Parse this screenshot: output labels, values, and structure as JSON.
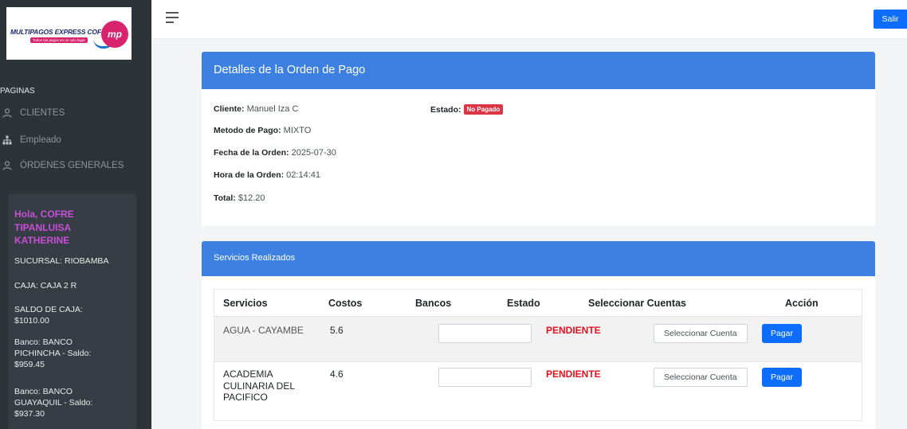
{
  "brand": {
    "name": "MULTIPAGOS EXPRESS COFRE",
    "tagline": "Todos tus pagos en un solo lugar",
    "mark": "mp"
  },
  "sidebar": {
    "section_label": "PAGINAS",
    "items": [
      {
        "label": "CLIENTES",
        "icon": "user-icon"
      },
      {
        "label": "Empleado",
        "icon": "org-chart-icon"
      },
      {
        "label": "ÓRDENES GENERALES",
        "icon": "user-icon"
      }
    ],
    "user": {
      "greeting": "Hola, COFRE TIPANLUISA KATHERINE",
      "sucursal": "SUCURSAL: RIOBAMBA",
      "caja": "CAJA: CAJA 2 R",
      "saldo": "SALDO DE CAJA: $1010.00",
      "banco1": "Banco: BANCO PICHINCHA - Saldo: $959.45",
      "banco2": "Banco: BANCO GUAYAQUIL - Saldo: $937.30"
    }
  },
  "topbar": {
    "logout_label": "Salir"
  },
  "order": {
    "title": "Detalles de la Orden de Pago",
    "cliente_label": "Cliente:",
    "cliente_value": "Manuel Iza C",
    "estado_label": "Estado:",
    "estado_value": "No Pagado",
    "metodo_label": "Metodo de Pago:",
    "metodo_value": "MIXTO",
    "fecha_label": "Fecha de la Orden:",
    "fecha_value": "2025-07-30",
    "hora_label": "Hora de la Orden:",
    "hora_value": "02:14:41",
    "total_label": "Total:",
    "total_value": "$12.20"
  },
  "services": {
    "title": "Servicios Realizados",
    "columns": [
      "Servicios",
      "Costos",
      "Bancos",
      "Estado",
      "Seleccionar Cuentas",
      "Acción"
    ],
    "rows": [
      {
        "servicio": "AGUA - CAYAMBE",
        "costo": "5.6",
        "banco": "",
        "estado": "PENDIENTE",
        "cuenta_placeholder": "Seleccionar Cuenta",
        "accion": "Pagar"
      },
      {
        "servicio": "ACADEMIA CULINARIA DEL PACIFICO",
        "costo": "4.6",
        "banco": "",
        "estado": "PENDIENTE",
        "cuenta_placeholder": "Seleccionar Cuenta",
        "accion": "Pagar"
      }
    ]
  },
  "colors": {
    "sidebar_bg": "#2c3339",
    "header_blue": "#3c80e1",
    "primary": "#0d6efd",
    "danger": "#dc3545",
    "greeting": "#c84fd8"
  }
}
